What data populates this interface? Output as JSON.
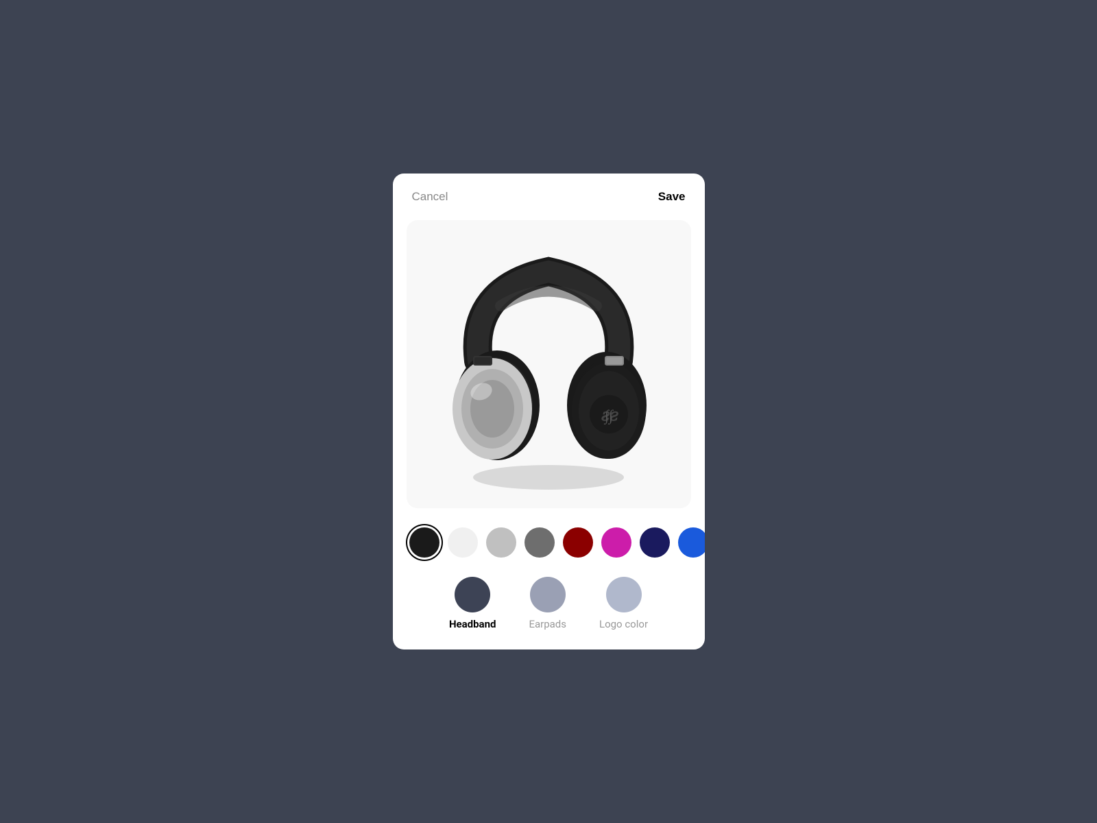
{
  "header": {
    "cancel_label": "Cancel",
    "save_label": "Save"
  },
  "colors": [
    {
      "id": "black",
      "hex": "#1a1a1a",
      "selected": true
    },
    {
      "id": "white",
      "hex": "#f0f0f0",
      "selected": false
    },
    {
      "id": "light-gray",
      "hex": "#c0c0c0",
      "selected": false
    },
    {
      "id": "medium-gray",
      "hex": "#6e6e6e",
      "selected": false
    },
    {
      "id": "dark-red",
      "hex": "#8b0000",
      "selected": false
    },
    {
      "id": "magenta",
      "hex": "#cc1daa",
      "selected": false
    },
    {
      "id": "dark-navy",
      "hex": "#1a1a5e",
      "selected": false
    },
    {
      "id": "blue",
      "hex": "#1a5adc",
      "selected": false
    },
    {
      "id": "teal",
      "hex": "#009090",
      "selected": false
    }
  ],
  "parts": [
    {
      "id": "headband",
      "label": "Headband",
      "color": "#3d4355",
      "active": true
    },
    {
      "id": "earpads",
      "label": "Earpads",
      "color": "#9aa0b4",
      "active": false
    },
    {
      "id": "logo-color",
      "label": "Logo color",
      "color": "#b0b8cc",
      "active": false
    }
  ]
}
